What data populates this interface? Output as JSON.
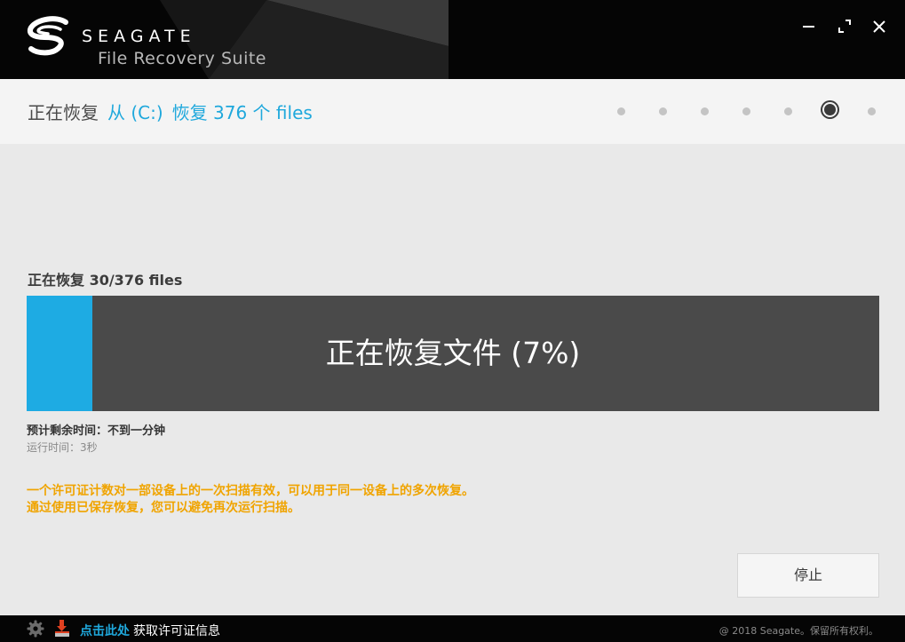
{
  "window": {
    "brand": "SEAGATE",
    "product": "File Recovery Suite",
    "controls": {
      "minimize_icon": "minimize-icon",
      "maximize_icon": "maximize-icon",
      "close_icon": "close-icon"
    }
  },
  "step": {
    "label": "正在恢复",
    "source": "从 (C:)",
    "summary": "恢复 376 个 files",
    "total_steps": 7,
    "current_step": 6
  },
  "progress": {
    "caption": "正在恢复 30/376 files",
    "bar_text": "正在恢复文件 (7%)",
    "percent": 7,
    "remaining": "预计剩余时间：不到一分钟",
    "elapsed": "运行时间：3秒"
  },
  "notice": {
    "line1": "一个许可证计数对一部设备上的一次扫描有效，可以用于同一设备上的多次恢复。",
    "line2": "通过使用已保存恢复，您可以避免再次运行扫描。"
  },
  "actions": {
    "stop_label": "停止"
  },
  "footer": {
    "link_label": "点击此处",
    "text": "获取许可证信息",
    "copyright": "@ 2018 Seagate。保留所有权利。"
  },
  "colors": {
    "accent": "#1fa8dc",
    "progress_fill": "#1eabe3",
    "progress_track": "#4a4a4a",
    "notice": "#f0a400",
    "titlebar": "#050505"
  }
}
